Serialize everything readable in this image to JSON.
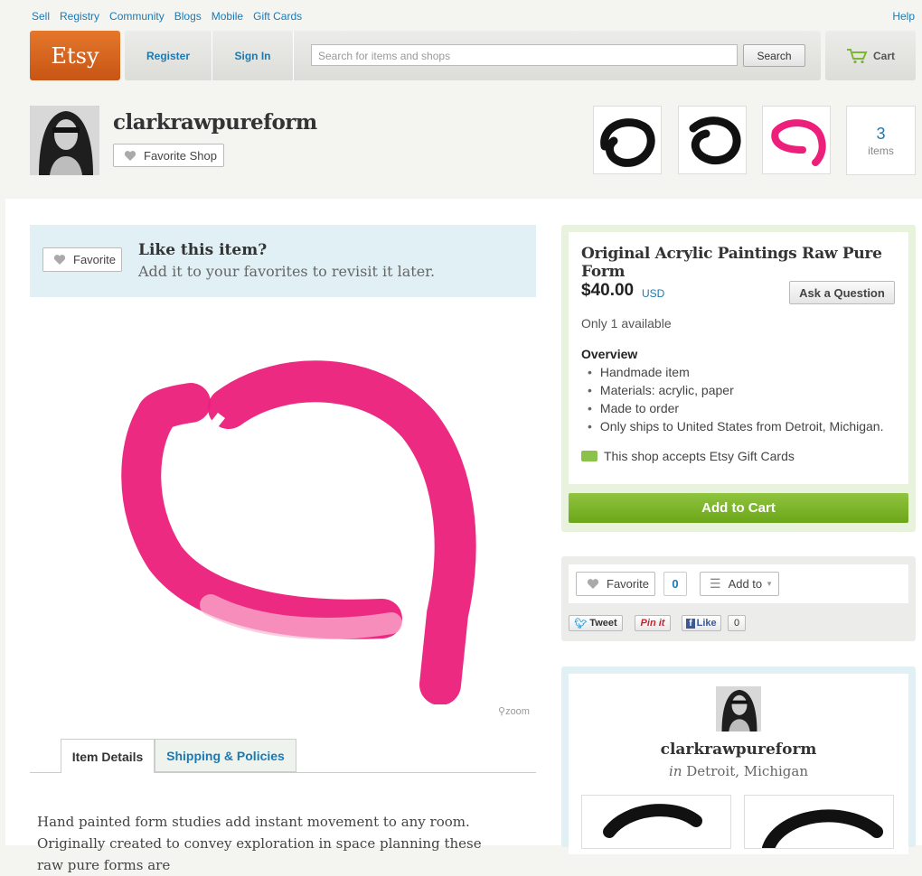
{
  "topnav": {
    "links": [
      "Sell",
      "Registry",
      "Community",
      "Blogs",
      "Mobile",
      "Gift Cards"
    ],
    "help": "Help"
  },
  "header": {
    "logo": "Etsy",
    "register": "Register",
    "signin": "Sign In",
    "search_placeholder": "Search for items and shops",
    "search_button": "Search",
    "cart": "Cart"
  },
  "shop": {
    "name": "clarkrawpureform",
    "favorite_shop": "Favorite Shop",
    "item_count": "3",
    "items_label": "items",
    "thumb_colors": [
      "#111111",
      "#111111",
      "#e8237a"
    ]
  },
  "favorite_prompt": {
    "button": "Favorite",
    "title": "Like this item?",
    "subtitle": "Add it to your favorites to revisit it later."
  },
  "image": {
    "zoom": "zoom",
    "stroke_color": "#ec1f7b"
  },
  "tabs": [
    {
      "label": "Item Details"
    },
    {
      "label": "Shipping & Policies"
    }
  ],
  "description": "Hand painted form studies add instant movement to any room. Originally created to convey exploration in space planning these raw pure forms are",
  "listing": {
    "title": "Original Acrylic Paintings Raw Pure Form",
    "price": "$40.00",
    "currency": "USD",
    "ask_button": "Ask a Question",
    "availability": "Only 1 available",
    "overview_heading": "Overview",
    "overview": [
      "Handmade item",
      "Materials: acrylic, paper",
      "Made to order",
      "Only ships to United States from Detroit, Michigan."
    ],
    "gift_cards": "This shop accepts Etsy Gift Cards",
    "add_to_cart": "Add to Cart"
  },
  "social": {
    "favorite": "Favorite",
    "favorite_count": "0",
    "add_to": "Add to",
    "tweet": "Tweet",
    "pin": "Pin it",
    "like": "Like",
    "like_count": "0"
  },
  "owner": {
    "name": "clarkrawpureform",
    "in": "in",
    "location": "Detroit, Michigan"
  },
  "colors": {
    "accent": "#1a7ab5",
    "logo": "#d5641c",
    "cart_button": "#7cb82f",
    "pink": "#ec1f7b"
  }
}
